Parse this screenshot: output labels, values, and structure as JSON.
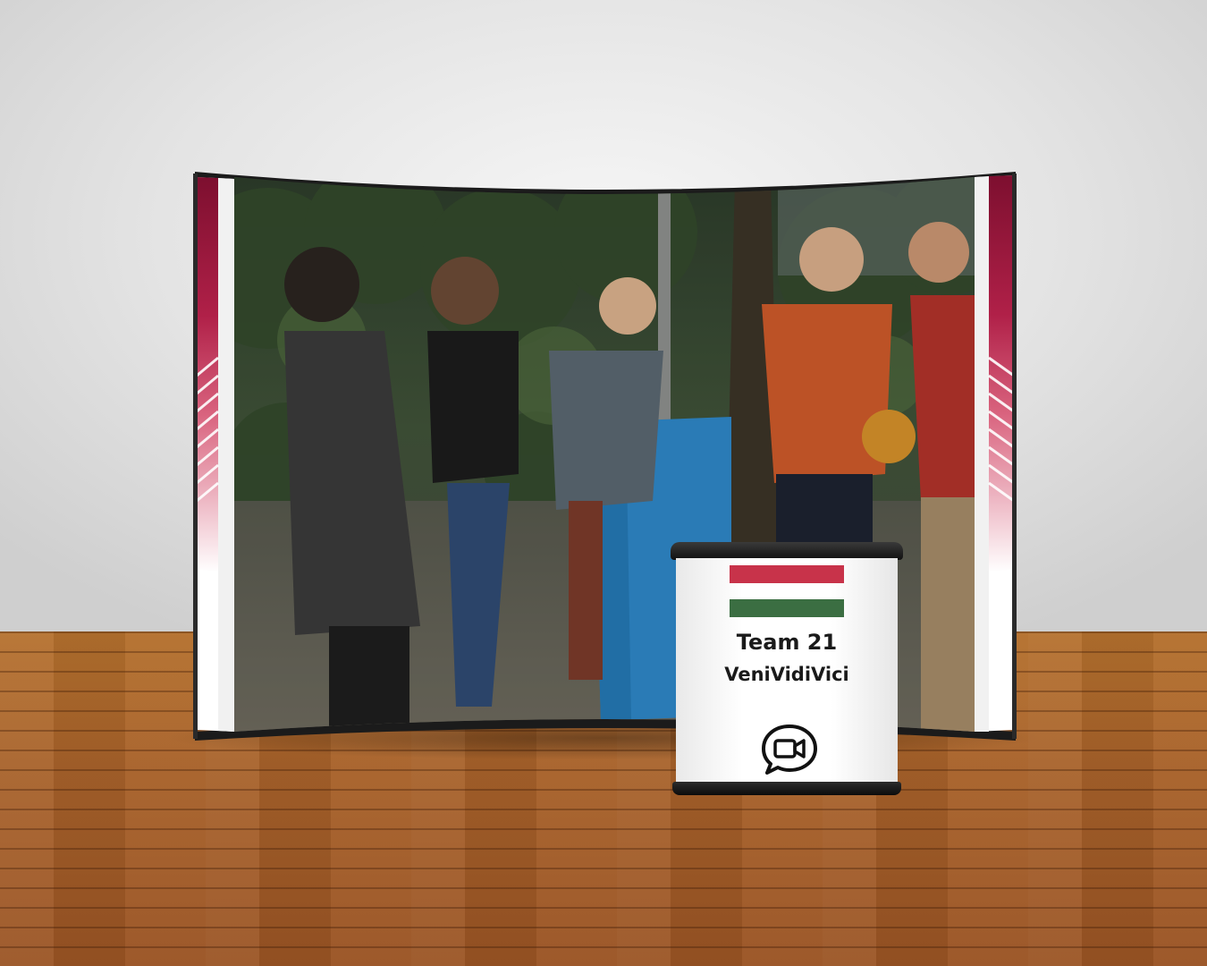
{
  "booth": {
    "team_label": "Team 21",
    "team_name": "VeniVidiVici"
  },
  "colors": {
    "flag_red": "#c8334a",
    "flag_green": "#3b6e42",
    "accent_crimson": "#8a1434"
  },
  "icons": {
    "video_chat": "video-chat-bubble-icon"
  }
}
